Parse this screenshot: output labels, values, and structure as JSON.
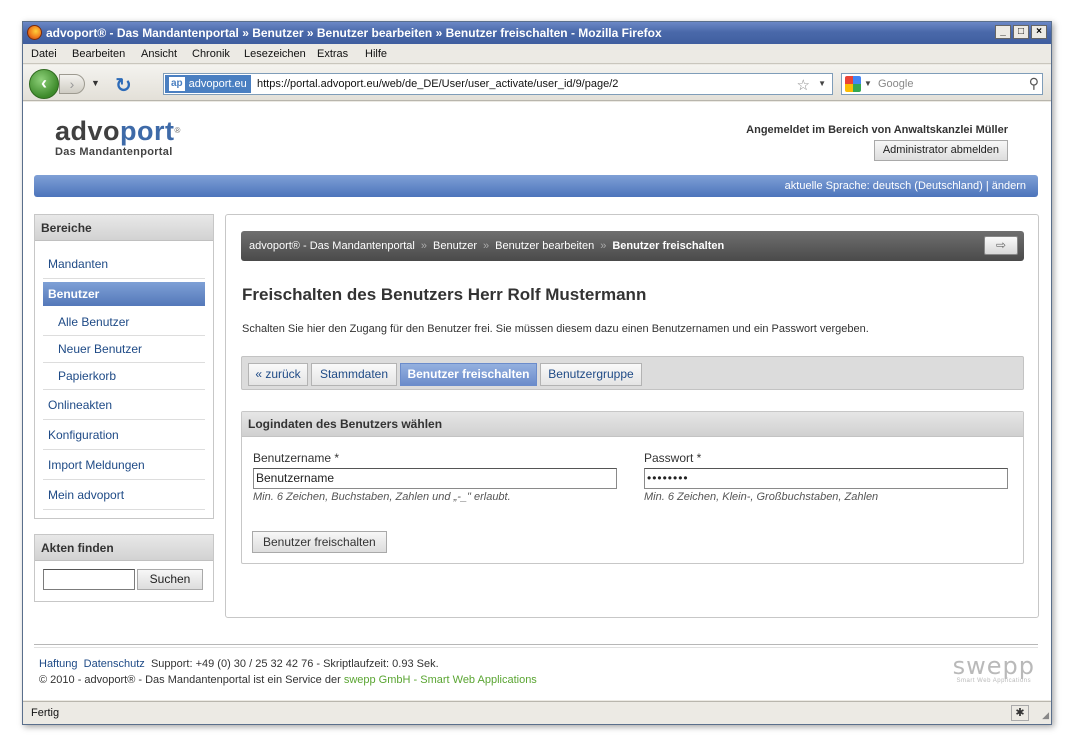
{
  "window": {
    "title": "advoport® - Das Mandantenportal » Benutzer » Benutzer bearbeiten » Benutzer freischalten - Mozilla Firefox",
    "min": "_",
    "max": "□",
    "close": "×"
  },
  "menu": [
    "Datei",
    "Bearbeiten",
    "Ansicht",
    "Chronik",
    "Lesezeichen",
    "Extras",
    "Hilfe"
  ],
  "browser": {
    "site_id_icon": "ap",
    "site_id": "advoport.eu",
    "url": "https://portal.advoport.eu/web/de_DE/User/user_activate/user_id/9/page/2",
    "search_placeholder": "Google",
    "status": "Fertig"
  },
  "header": {
    "logo_part1": "advo",
    "logo_part2": "port",
    "logo_reg": "®",
    "tagline": "Das Mandantenportal",
    "login_info": "Angemeldet im Bereich von Anwaltskanzlei Müller",
    "logout_label": "Administrator abmelden",
    "language_bar": "aktuelle Sprache: deutsch (Deutschland) | ändern"
  },
  "sidebar": {
    "title": "Bereiche",
    "items": [
      {
        "label": "Mandanten"
      },
      {
        "label": "Benutzer"
      },
      {
        "label": "Alle Benutzer"
      },
      {
        "label": "Neuer Benutzer"
      },
      {
        "label": "Papierkorb"
      },
      {
        "label": "Onlineakten"
      },
      {
        "label": "Konfiguration"
      },
      {
        "label": "Import Meldungen"
      },
      {
        "label": "Mein advoport"
      }
    ],
    "search_title": "Akten finden",
    "search_button": "Suchen"
  },
  "breadcrumb": {
    "items": [
      "advoport® - Das Mandantenportal",
      "Benutzer",
      "Benutzer bearbeiten"
    ],
    "current": "Benutzer freischalten",
    "separator": "»"
  },
  "main": {
    "title": "Freischalten des Benutzers Herr Rolf Mustermann",
    "intro": "Schalten Sie hier den Zugang für den Benutzer frei. Sie müssen diesem dazu einen Benutzernamen und ein Passwort vergeben.",
    "tabs": [
      {
        "label": "« zurück"
      },
      {
        "label": "Stammdaten"
      },
      {
        "label": "Benutzer freischalten"
      },
      {
        "label": "Benutzergruppe"
      }
    ],
    "form": {
      "title": "Logindaten des Benutzers wählen",
      "username_label": "Benutzername *",
      "username_value": "Benutzername",
      "username_hint": "Min. 6 Zeichen, Buchstaben, Zahlen und „-_\" erlaubt.",
      "password_label": "Passwort *",
      "password_value": "••••••••",
      "password_hint": "Min. 6 Zeichen, Klein-, Großbuchstaben, Zahlen",
      "submit_label": "Benutzer freischalten"
    }
  },
  "footer": {
    "link1": "Haftung",
    "link2": "Datenschutz",
    "support": "Support: +49 (0) 30 / 25 32 42 76 - Skriptlaufzeit: 0.93 Sek.",
    "copyright": "© 2010 - advoport® - Das Mandantenportal ist ein Service der",
    "service": "swepp GmbH - Smart Web Applications",
    "brand": "swepp",
    "brand_sub": "Smart Web Applications"
  }
}
